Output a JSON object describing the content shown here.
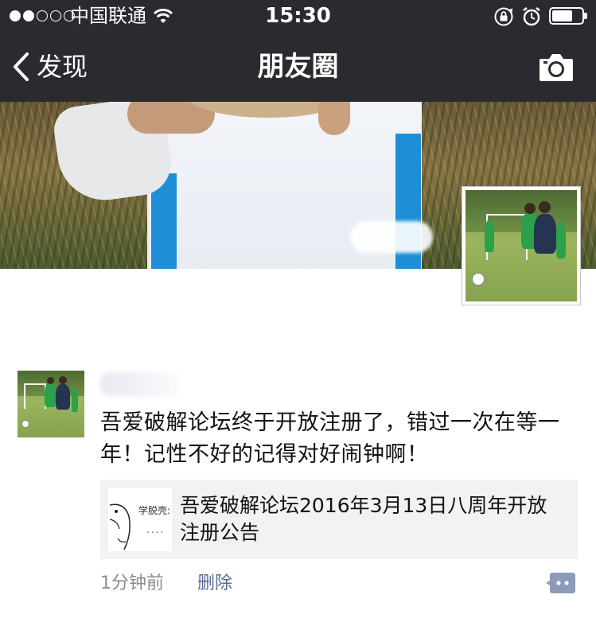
{
  "status_bar": {
    "signal_bars_filled": 2,
    "signal_bars_total": 5,
    "carrier": "中国联通",
    "time": "15:30",
    "battery_level": 0.7,
    "icons": [
      "wifi-icon",
      "rotation-lock-icon",
      "alarm-icon",
      "battery-icon"
    ]
  },
  "nav": {
    "back_label": "发现",
    "title": "朋友圈",
    "right_icon": "camera-icon"
  },
  "post": {
    "author_name": "",
    "text": "吾爱破解论坛终于开放注册了，错过一次在等一年！记性不好的记得对好闹钟啊！",
    "link": {
      "thumb_text": "学脱壳:",
      "thumb_dots": "....",
      "title": "吾爱破解论坛2016年3月13日八周年开放注册公告"
    },
    "time": "1分钟前",
    "delete_label": "删除",
    "comment_icon": "comment-icon"
  },
  "colors": {
    "topbar_bg": "#2b2a2f",
    "link_blue": "#576b95",
    "meta_gray": "#8c8c8c",
    "card_bg": "#f2f2f5"
  }
}
